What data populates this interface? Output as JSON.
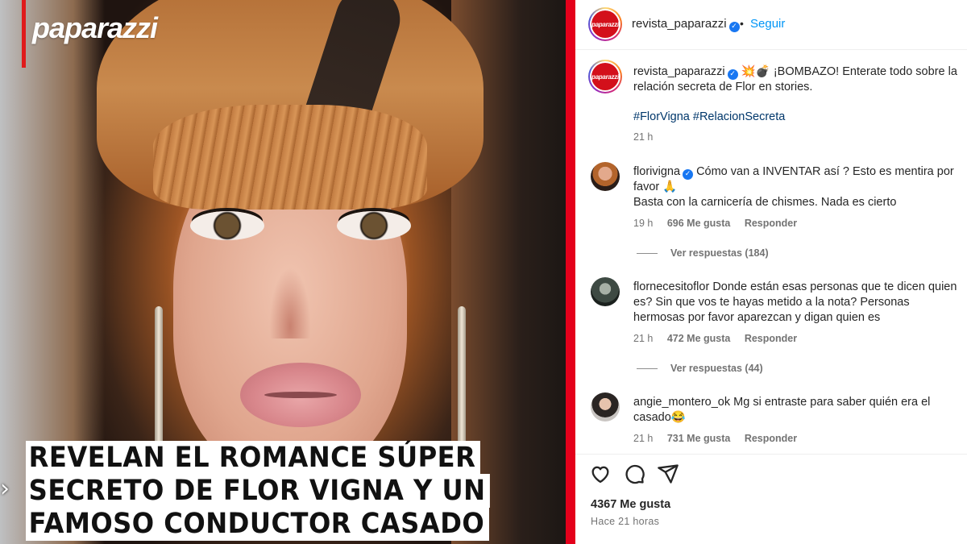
{
  "photo": {
    "logo": "paparazzi",
    "headline": [
      "REVELAN EL ROMANCE SÚPER",
      "SECRETO DE FLOR VIGNA Y UN",
      "FAMOSO CONDUCTOR CASADO"
    ],
    "nav_arrow": "›"
  },
  "header": {
    "avatar_text": "paparazzi",
    "username": "revista_paparazzi",
    "dot": "•",
    "follow_label": "Seguir"
  },
  "caption": {
    "username": "revista_paparazzi",
    "text": "💥💣 ¡BOMBAZO! Enterate todo sobre la relación secreta de Flor en stories.",
    "hashtags": "#FlorVigna #RelacionSecreta",
    "time": "21 h"
  },
  "comments": [
    {
      "username": "florivigna",
      "verified": true,
      "text": "Cómo van a INVENTAR así ? Esto es mentira por favor 🙏",
      "text2": "Basta con la carnicería de chismes. Nada es cierto",
      "time": "19 h",
      "likes": "696 Me gusta",
      "reply": "Responder",
      "view_replies": "Ver respuestas (184)"
    },
    {
      "username": "flornecesitoflor",
      "verified": false,
      "text": "Donde están esas personas que te dicen quien es? Sin que vos te hayas metido a la nota? Personas hermosas por favor aparezcan y digan quien es",
      "time": "21 h",
      "likes": "472 Me gusta",
      "reply": "Responder",
      "view_replies": "Ver respuestas (44)"
    },
    {
      "username": "angie_montero_ok",
      "verified": false,
      "text": "Mg si entraste para saber quién era el casado😂",
      "time": "21 h",
      "likes": "731 Me gusta",
      "reply": "Responder"
    }
  ],
  "actions": {
    "likes_total": "4367 Me gusta",
    "time_ago": "Hace 21 horas",
    "icons": [
      "heart-icon",
      "comment-icon",
      "share-icon"
    ]
  },
  "colors": {
    "accent_red": "#e4001b",
    "link_blue": "#0095f6",
    "hashtag_blue": "#00376b",
    "verified_blue": "#1877f2"
  }
}
